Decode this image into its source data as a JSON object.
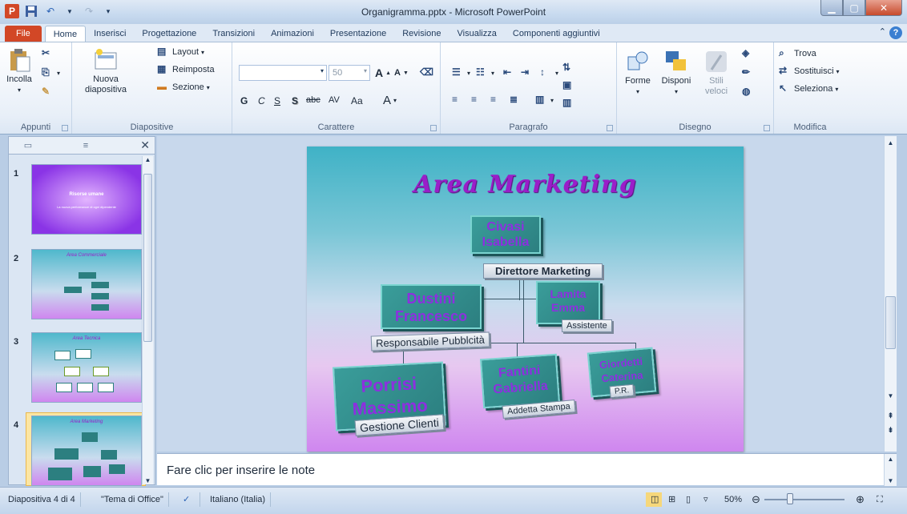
{
  "window": {
    "title": "Organigramma.pptx - Microsoft PowerPoint"
  },
  "tabs": [
    "File",
    "Home",
    "Inserisci",
    "Progettazione",
    "Transizioni",
    "Animazioni",
    "Presentazione",
    "Revisione",
    "Visualizza",
    "Componenti aggiuntivi"
  ],
  "ribbon": {
    "appunti": {
      "label": "Appunti",
      "paste": "Incolla"
    },
    "diapositive": {
      "label": "Diapositive",
      "new_slide_1": "Nuova",
      "new_slide_2": "diapositiva",
      "layout": "Layout",
      "reset": "Reimposta",
      "section": "Sezione"
    },
    "carattere": {
      "label": "Carattere",
      "font_size": "50",
      "bold": "G",
      "italic": "C",
      "underline": "S",
      "shadow": "S",
      "strike": "abc",
      "spacing": "AV",
      "case": "Aa"
    },
    "paragrafo": {
      "label": "Paragrafo"
    },
    "disegno": {
      "label": "Disegno",
      "shapes": "Forme",
      "arrange": "Disponi",
      "quick_styles_1": "Stili",
      "quick_styles_2": "veloci"
    },
    "modifica": {
      "label": "Modifica",
      "find": "Trova",
      "replace": "Sostituisci",
      "select": "Seleziona"
    }
  },
  "slides_pane": {
    "thumbs": [
      {
        "num": "1",
        "title": "Risorse umane",
        "subtitle": "La nuova performance di ogni dipendente"
      },
      {
        "num": "2",
        "title": "Area Commerciale"
      },
      {
        "num": "3",
        "title": "Area Tecnica"
      },
      {
        "num": "4",
        "title": "Area Marketing"
      }
    ]
  },
  "slide": {
    "title": "Area Marketing",
    "nodes": [
      {
        "name_1": "Civasi",
        "name_2": "Isabella",
        "role": "Direttore Marketing"
      },
      {
        "name_1": "Dustini",
        "name_2": "Francesco",
        "role": "Responsabile Pubblcità"
      },
      {
        "name_1": "Lamita",
        "name_2": "Emma",
        "role": "Assistente"
      },
      {
        "name_1": "Porrisi",
        "name_2": "Massimo",
        "role": "Gestione Clienti"
      },
      {
        "name_1": "Fantini",
        "name_2": "Gabriella",
        "role": "Addetta Stampa"
      },
      {
        "name_1": "Giordetti",
        "name_2": "Caterina",
        "role": "P.R."
      }
    ]
  },
  "notes": {
    "placeholder": "Fare clic per inserire le note"
  },
  "status": {
    "slide_info": "Diapositiva 4 di 4",
    "theme": "\"Tema di Office\"",
    "language": "Italiano (Italia)",
    "zoom": "50%"
  },
  "colors": {
    "file_tab": "#d24726",
    "title_text": "#9a1ec9",
    "box_fill": "#2c7f80"
  }
}
